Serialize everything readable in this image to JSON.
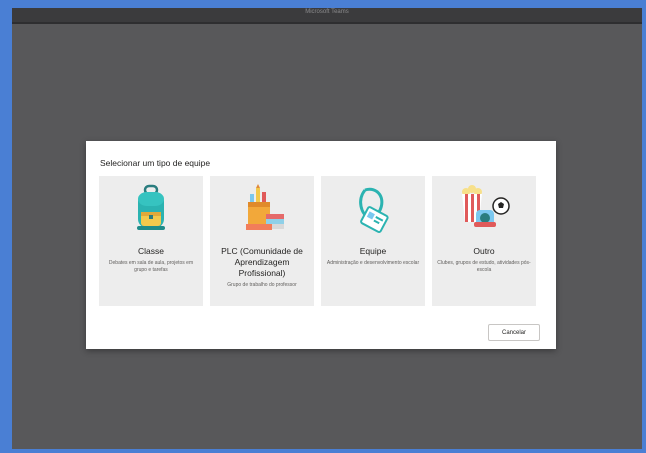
{
  "window": {
    "title": "Microsoft Teams"
  },
  "dialog": {
    "title": "Selecionar um tipo de equipe",
    "cancel_label": "Cancelar",
    "cards": [
      {
        "icon": "backpack-icon",
        "title": "Classe",
        "description": "Debates em sala de aula, projetos em grupo e tarefas"
      },
      {
        "icon": "books-pencils-icon",
        "title": "PLC (Comunidade de Aprendizagem Profissional)",
        "description": "Grupo de trabalho do professor"
      },
      {
        "icon": "id-badge-icon",
        "title": "Equipe",
        "description": "Administração e desenvolvimento escolar"
      },
      {
        "icon": "popcorn-ball-icon",
        "title": "Outro",
        "description": "Clubes, grupos de estudo, atividades pós-escola"
      }
    ]
  },
  "colors": {
    "backdrop": "#58585a",
    "frame": "#4a7fd4",
    "card_bg": "#ededed"
  }
}
